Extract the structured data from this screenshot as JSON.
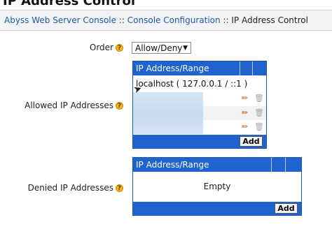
{
  "page": {
    "title": "IP Address Control",
    "breadcrumb": {
      "link1": "Abyss Web Server Console",
      "sep1": "::",
      "link2": "Console Configuration",
      "sep2": "::",
      "current": "IP Address Control"
    }
  },
  "order": {
    "label": "Order",
    "help": "?",
    "value": "Allow/Deny",
    "options": [
      "Allow/Deny"
    ]
  },
  "allowed": {
    "label": "Allowed IP Addresses",
    "help": "?",
    "column_header": "IP Address/Range",
    "rows": [
      {
        "value": "localhost ( 127.0.0.1 / ::1 )"
      },
      {
        "value": ""
      },
      {
        "value": ""
      }
    ],
    "add_label": "Add"
  },
  "denied": {
    "label": "Denied IP Addresses",
    "help": "?",
    "column_header": "IP Address/Range",
    "empty_text": "Empty",
    "add_label": "Add"
  },
  "icons": {
    "edit": "pencil-icon",
    "delete": "trash-icon",
    "help": "question-circle-icon",
    "cursor": "mouse-pointer-icon"
  },
  "colors": {
    "table_header": "#1f63cf",
    "link": "#1b5aa6",
    "help_icon": "#f2b21b",
    "edit_icon": "#c94a00"
  }
}
